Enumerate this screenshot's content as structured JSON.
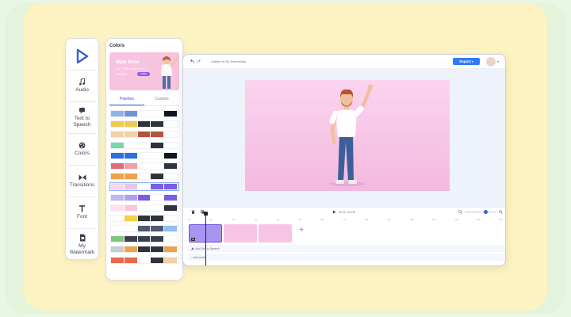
{
  "tools": [
    {
      "label": "Audio",
      "icon": "music-note-icon"
    },
    {
      "label": "Text to Speech",
      "icon": "speech-icon"
    },
    {
      "label": "Colors",
      "icon": "palette-icon"
    },
    {
      "label": "Transitions",
      "icon": "bowtie-icon"
    },
    {
      "label": "Font",
      "icon": "font-icon"
    },
    {
      "label": "My Watermark",
      "icon": "watermark-icon"
    }
  ],
  "colors_panel": {
    "title": "Colors",
    "banner": {
      "heading": "Main Error",
      "sub": "BOTTOM SUBTITLE",
      "line": "Left Text",
      "pill": "LABEL"
    },
    "tabs": [
      "Palettes",
      "Custom"
    ],
    "palettes": [
      [
        "#8fb3e8",
        "#6e94d8",
        "#ffffff",
        "#ffffff",
        "#11151f"
      ],
      [
        "#f2c94c",
        "#f2c94c",
        "#2f3340",
        "#2f3340",
        "#ffffff"
      ],
      [
        "#f2d1a8",
        "#f2d1a8",
        "#b5533c",
        "#b5533c",
        "#ffffff"
      ],
      [
        "#74d9a8",
        "#ffffff",
        "#ffffff",
        "#2f3340",
        "#ffffff"
      ],
      [
        "#2f6fe0",
        "#2f6fe0",
        "#ffffff",
        "#ffffff",
        "#11151f"
      ],
      [
        "#e06b7a",
        "#f0a0a8",
        "#ffffff",
        "#ffffff",
        "#2f3340"
      ],
      [
        "#f0a24a",
        "#f0a24a",
        "#ffffff",
        "#2f3340",
        "#ffffff"
      ],
      [
        "#f7d6ee",
        "#eac4e4",
        "#ffffff",
        "#7c5ce6",
        "#7c5ce6"
      ],
      [
        "#c2b4f4",
        "#b19ef0",
        "#7c5ce6",
        "#ffffff",
        "#7c5ce6"
      ],
      [
        "#fbe0ef",
        "#f7c7e0",
        "#ffffff",
        "#ffffff",
        "#2f3340"
      ],
      [
        "#ffffff",
        "#f2d04a",
        "#2f3340",
        "#2f3340",
        "#ffffff"
      ],
      [
        "#ffffff",
        "#ffffff",
        "#4f5a70",
        "#4f5a70",
        "#8fc0f0"
      ],
      [
        "#7cc97c",
        "#3a3f4e",
        "#3a3f4e",
        "#3a3f4e",
        "#ffffff"
      ],
      [
        "#c9ccd4",
        "#f0a24a",
        "#2f3340",
        "#2f3340",
        "#f0a24a"
      ],
      [
        "#e86a4a",
        "#e86a4a",
        "#ffffff",
        "#2f3340",
        "#f2d1a8"
      ]
    ]
  },
  "editor": {
    "project_title": "Gallery of 3D Animations",
    "export_label": "Export",
    "current_time": "00:01 / 00:08",
    "ruler": [
      "0s",
      "1s",
      "2s",
      "3s",
      "4s",
      "5s",
      "6s",
      "7s",
      "8s",
      "9s",
      "10s",
      "11s",
      "12s",
      "13s",
      "14s"
    ],
    "track_tts": "Add Text to Speech",
    "track_audio": "Add audio",
    "clip_time": "5s"
  }
}
